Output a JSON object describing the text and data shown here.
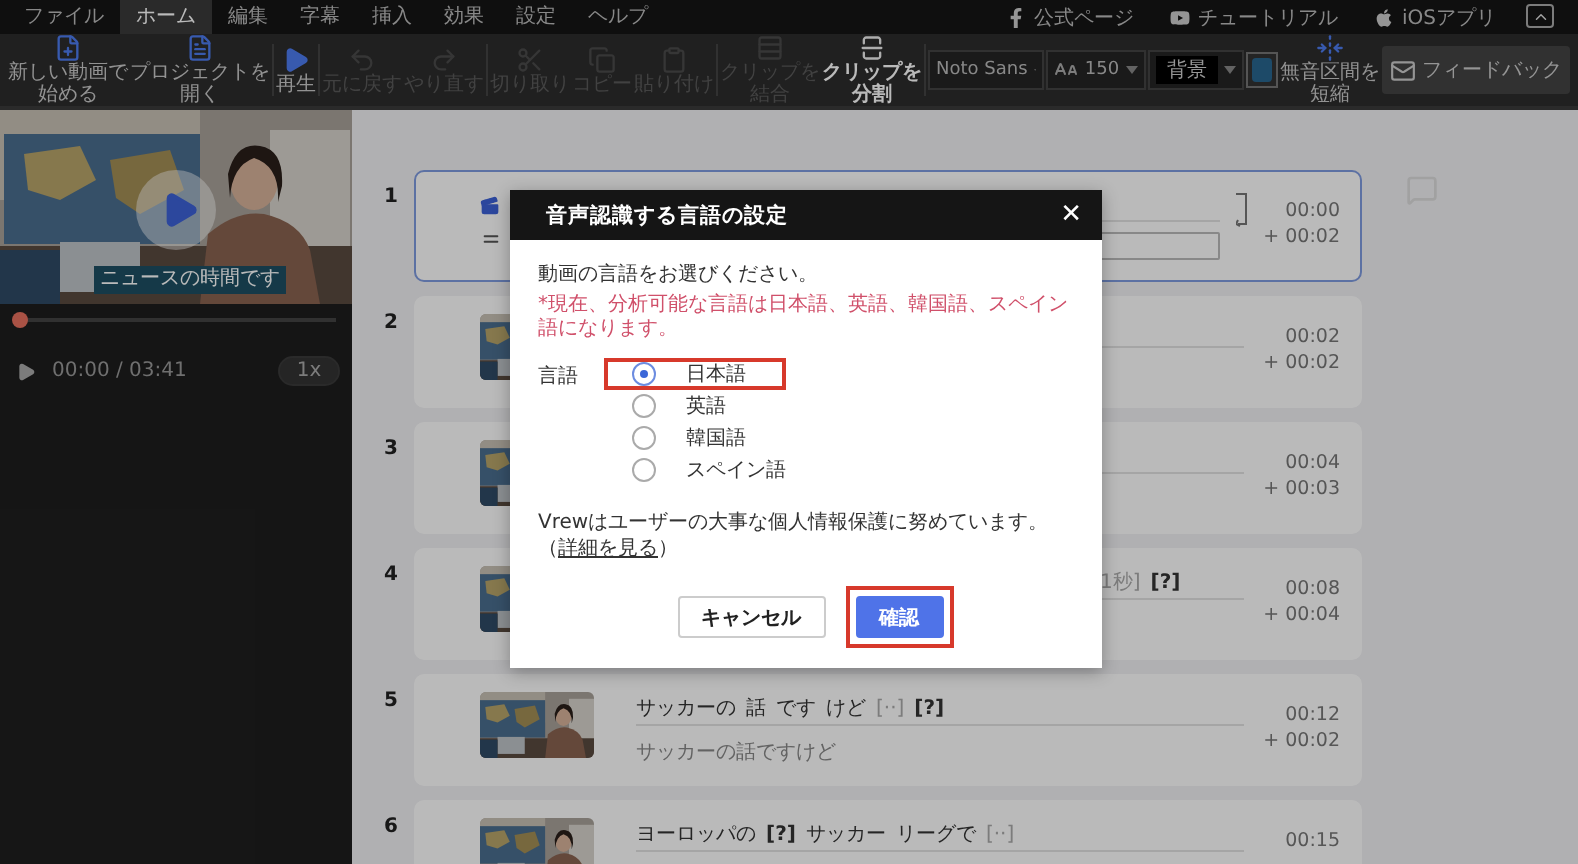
{
  "menu_bar": {
    "menus": [
      {
        "label": "ファイル",
        "selected": false
      },
      {
        "label": "ホーム",
        "selected": true
      },
      {
        "label": "編集",
        "selected": false
      },
      {
        "label": "字幕",
        "selected": false
      },
      {
        "label": "挿入",
        "selected": false
      },
      {
        "label": "効果",
        "selected": false
      },
      {
        "label": "設定",
        "selected": false
      },
      {
        "label": "ヘルプ",
        "selected": false
      }
    ],
    "links": [
      {
        "label": "公式ページ"
      },
      {
        "label": "チュートリアル"
      },
      {
        "label": "iOSアプリ"
      }
    ]
  },
  "toolbar": {
    "tools": [
      {
        "lines": [
          "新しい動画で",
          "始める"
        ],
        "disabled": false
      },
      {
        "lines": [
          "プロジェクトを",
          "開く"
        ],
        "disabled": false
      },
      {
        "lines": [
          "再生"
        ],
        "disabled": false
      },
      {
        "lines": [
          "元に戻す"
        ],
        "disabled": true
      },
      {
        "lines": [
          "やり直す"
        ],
        "disabled": true
      },
      {
        "lines": [
          "切り取り"
        ],
        "disabled": true
      },
      {
        "lines": [
          "コピー"
        ],
        "disabled": true
      },
      {
        "lines": [
          "貼り付け"
        ],
        "disabled": true
      },
      {
        "lines": [
          "クリップを",
          "結合"
        ],
        "disabled": true
      },
      {
        "lines": [
          "クリップを",
          "分割"
        ],
        "disabled": false
      }
    ],
    "font": "Noto Sans",
    "size": "150",
    "background": "背景",
    "color": "#1d4a68",
    "silence": [
      "無音区間を",
      "短縮"
    ],
    "feedback": "フィードバック"
  },
  "player": {
    "subtitle": "ニュースの時間です",
    "level": 0,
    "time": "00:00 / 03:41",
    "speed": "1x"
  },
  "clips": [
    {
      "number": "1",
      "selected": true,
      "start": "00:00",
      "duration": "+ 00:02"
    },
    {
      "number": "2",
      "selected": false,
      "start": "00:02",
      "duration": "+ 00:02"
    },
    {
      "number": "3",
      "selected": false,
      "start": "00:04",
      "duration": "+ 00:03"
    },
    {
      "number": "4",
      "selected": false,
      "covered": true,
      "words": [
        {
          "text": "1秒]",
          "kind": "gap"
        },
        {
          "text": "[?]",
          "kind": "unknown"
        }
      ],
      "start": "00:08",
      "duration": "+ 00:04"
    },
    {
      "number": "5",
      "selected": false,
      "words": [
        {
          "text": "サッカーの",
          "kind": "word"
        },
        {
          "text": "話",
          "kind": "word"
        },
        {
          "text": "です",
          "kind": "word"
        },
        {
          "text": "けど",
          "kind": "word"
        },
        {
          "text": "[··]",
          "kind": "gap"
        },
        {
          "text": "[?]",
          "kind": "unknown"
        }
      ],
      "subtitle": "サッカーの話ですけど",
      "start": "00:12",
      "duration": "+ 00:02"
    },
    {
      "number": "6",
      "selected": false,
      "words": [
        {
          "text": "ヨーロッパの",
          "kind": "word"
        },
        {
          "text": "[?]",
          "kind": "unknown"
        },
        {
          "text": "サッカー",
          "kind": "word"
        },
        {
          "text": "リーグで",
          "kind": "word"
        },
        {
          "text": "[··]",
          "kind": "gap"
        }
      ],
      "start": "00:15"
    }
  ],
  "dialog": {
    "title": "音声認識する言語の設定",
    "close": "✕",
    "prompt": "動画の言語をお選びください。",
    "note": "*現在、分析可能な言語は日本語、英語、韓国語、スペイン語になります。",
    "field_label": "言語",
    "languages": [
      {
        "label": "日本語",
        "selected": true,
        "highlighted": true
      },
      {
        "label": "英語",
        "selected": false,
        "highlighted": false
      },
      {
        "label": "韓国語",
        "selected": false,
        "highlighted": false
      },
      {
        "label": "スペイン語",
        "selected": false,
        "highlighted": false
      }
    ],
    "privacy": "Vrewはユーザーの大事な個人情報保護に努めています。",
    "link_open": "（",
    "link": "詳細を見る",
    "link_close": "）",
    "buttons": [
      {
        "label": "キャンセル",
        "kind": "secondary",
        "highlighted": false
      },
      {
        "label": "確認",
        "kind": "primary",
        "highlighted": true
      }
    ]
  }
}
